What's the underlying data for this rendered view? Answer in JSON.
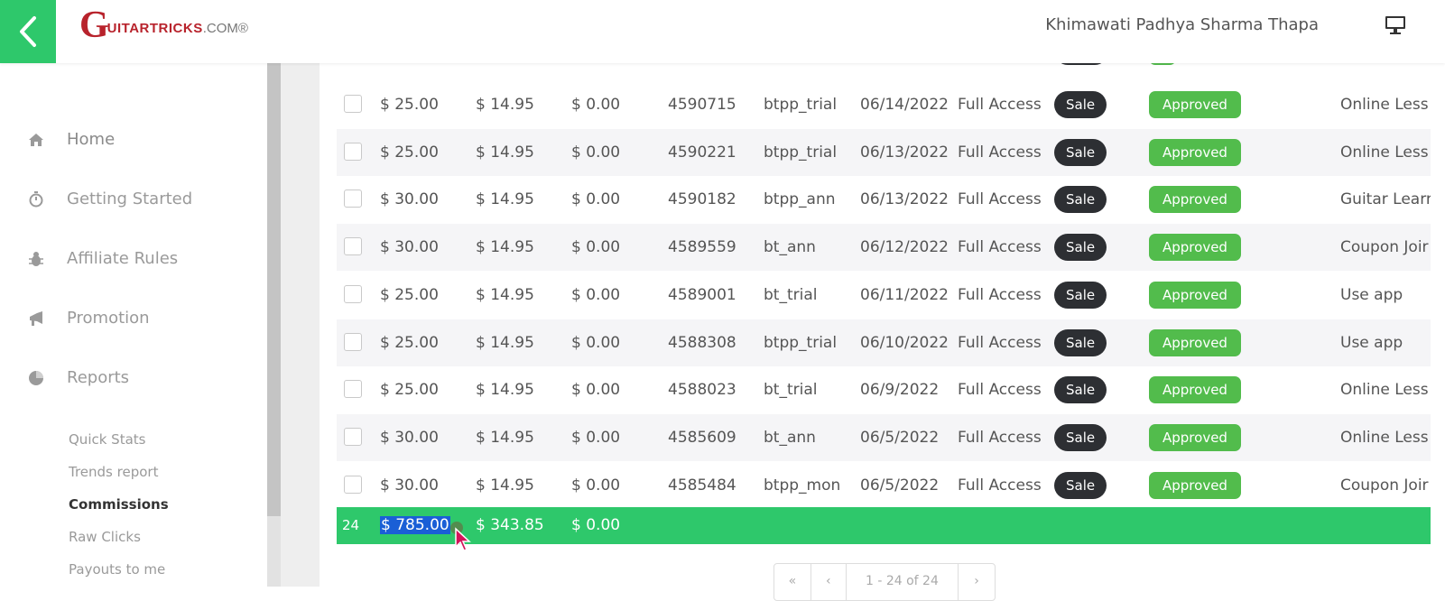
{
  "header": {
    "logo_main": "UITARTRICKS",
    "logo_letter": "G",
    "logo_suffix": ".COM®",
    "user_name": "Khimawati Padhya Sharma Thapa"
  },
  "sidebar": {
    "nav": [
      {
        "label": "Home",
        "icon": "home-icon"
      },
      {
        "label": "Getting Started",
        "icon": "stopwatch-icon"
      },
      {
        "label": "Affiliate Rules",
        "icon": "bug-icon"
      },
      {
        "label": "Promotion",
        "icon": "bullhorn-icon"
      },
      {
        "label": "Reports",
        "icon": "pie-chart-icon"
      }
    ],
    "sub": [
      {
        "label": "Quick Stats"
      },
      {
        "label": "Trends report"
      },
      {
        "label": "Commissions",
        "active": true
      },
      {
        "label": "Raw Clicks"
      },
      {
        "label": "Payouts to me"
      }
    ]
  },
  "table": {
    "rows": [
      {
        "total": "$ 25.00",
        "commission": "$ 14.95",
        "refund": "$ 0.00",
        "order_id": "4590715",
        "campaign": "btpp_trial",
        "date": "06/14/2022",
        "product": "Full Access",
        "type": "Sale",
        "status": "Approved",
        "notes": "Online Less"
      },
      {
        "total": "$ 25.00",
        "commission": "$ 14.95",
        "refund": "$ 0.00",
        "order_id": "4590221",
        "campaign": "btpp_trial",
        "date": "06/13/2022",
        "product": "Full Access",
        "type": "Sale",
        "status": "Approved",
        "notes": "Online Less"
      },
      {
        "total": "$ 30.00",
        "commission": "$ 14.95",
        "refund": "$ 0.00",
        "order_id": "4590182",
        "campaign": "btpp_ann",
        "date": "06/13/2022",
        "product": "Full Access",
        "type": "Sale",
        "status": "Approved",
        "notes": "Guitar Learr"
      },
      {
        "total": "$ 30.00",
        "commission": "$ 14.95",
        "refund": "$ 0.00",
        "order_id": "4589559",
        "campaign": "bt_ann",
        "date": "06/12/2022",
        "product": "Full Access",
        "type": "Sale",
        "status": "Approved",
        "notes": "Coupon Joir"
      },
      {
        "total": "$ 25.00",
        "commission": "$ 14.95",
        "refund": "$ 0.00",
        "order_id": "4589001",
        "campaign": "bt_trial",
        "date": "06/11/2022",
        "product": "Full Access",
        "type": "Sale",
        "status": "Approved",
        "notes": "Use app"
      },
      {
        "total": "$ 25.00",
        "commission": "$ 14.95",
        "refund": "$ 0.00",
        "order_id": "4588308",
        "campaign": "btpp_trial",
        "date": "06/10/2022",
        "product": "Full Access",
        "type": "Sale",
        "status": "Approved",
        "notes": "Use app"
      },
      {
        "total": "$ 25.00",
        "commission": "$ 14.95",
        "refund": "$ 0.00",
        "order_id": "4588023",
        "campaign": "bt_trial",
        "date": "06/9/2022",
        "product": "Full Access",
        "type": "Sale",
        "status": "Approved",
        "notes": "Online Less"
      },
      {
        "total": "$ 30.00",
        "commission": "$ 14.95",
        "refund": "$ 0.00",
        "order_id": "4585609",
        "campaign": "bt_ann",
        "date": "06/5/2022",
        "product": "Full Access",
        "type": "Sale",
        "status": "Approved",
        "notes": "Online Less"
      },
      {
        "total": "$ 30.00",
        "commission": "$ 14.95",
        "refund": "$ 0.00",
        "order_id": "4585484",
        "campaign": "btpp_mon",
        "date": "06/5/2022",
        "product": "Full Access",
        "type": "Sale",
        "status": "Approved",
        "notes": "Coupon Joir"
      }
    ],
    "totals": {
      "count": "24",
      "total": "$ 785.00",
      "commission": "$ 343.85",
      "refund": "$ 0.00"
    }
  },
  "pagination": {
    "first": "«",
    "prev": "‹",
    "info": "1 - 24 of 24",
    "next": "›"
  },
  "colors": {
    "accent": "#2ec86b",
    "approved": "#52bc4c",
    "sale_badge": "#2d2f33",
    "brand": "#b8232c"
  }
}
